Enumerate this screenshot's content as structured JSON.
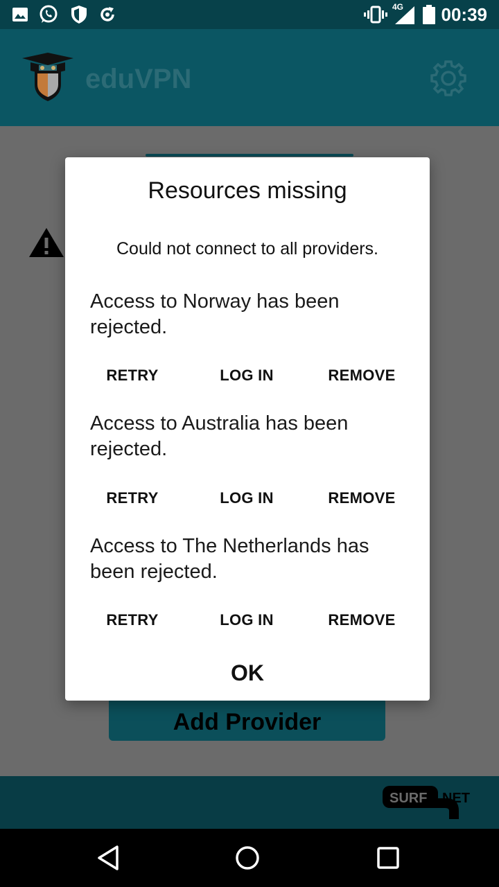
{
  "status_bar": {
    "time": "00:39",
    "network": "4G",
    "icons": [
      "image-icon",
      "whatsapp-icon",
      "shield-icon",
      "sync-icon",
      "vibrate-icon",
      "signal-icon",
      "battery-icon"
    ]
  },
  "app_bar": {
    "title": "eduVPN",
    "logo_icon": "eduvpn-logo",
    "settings_icon": "gear-icon"
  },
  "main": {
    "add_provider_label": "Add Provider",
    "warning_icon": "warning-icon"
  },
  "footer": {
    "logo_label": "SURF NET"
  },
  "dialog": {
    "title": "Resources missing",
    "message": "Could not connect to all providers.",
    "providers": [
      {
        "text": "Access to Norway has been rejected.",
        "retry": "RETRY",
        "login": "LOG IN",
        "remove": "REMOVE"
      },
      {
        "text": "Access to Australia has been rejected.",
        "retry": "RETRY",
        "login": "LOG IN",
        "remove": "REMOVE"
      },
      {
        "text": "Access to The Netherlands has been rejected.",
        "retry": "RETRY",
        "login": "LOG IN",
        "remove": "REMOVE"
      }
    ],
    "ok_label": "OK"
  },
  "nav_bar": {
    "icons": [
      "back-icon",
      "home-icon",
      "recents-icon"
    ]
  },
  "colors": {
    "status_bar": "#07414a",
    "app_bar": "#0b5663",
    "overlay_bg": "#6b6b6b",
    "footer": "#083c45",
    "accent": "#0b4f5a"
  }
}
